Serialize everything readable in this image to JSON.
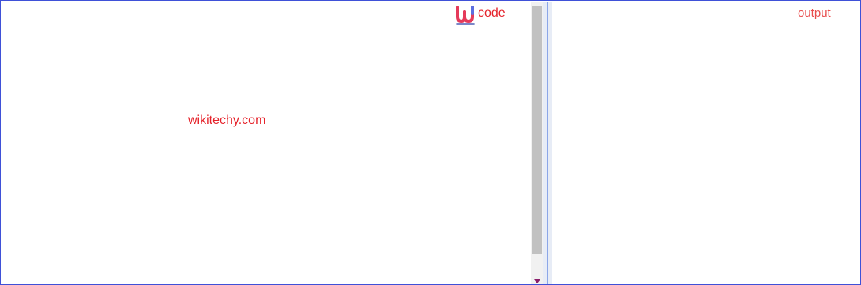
{
  "code_panel": {
    "label": "code",
    "content": "wikitechy.com",
    "logo_icon": "wikitechy-logo-icon"
  },
  "output_panel": {
    "label": "output"
  },
  "colors": {
    "accent_red": "#e5222a",
    "border_blue": "#3f51d8",
    "scroll_thumb": "#c1c1c1",
    "divider": "#8ba6e8"
  }
}
